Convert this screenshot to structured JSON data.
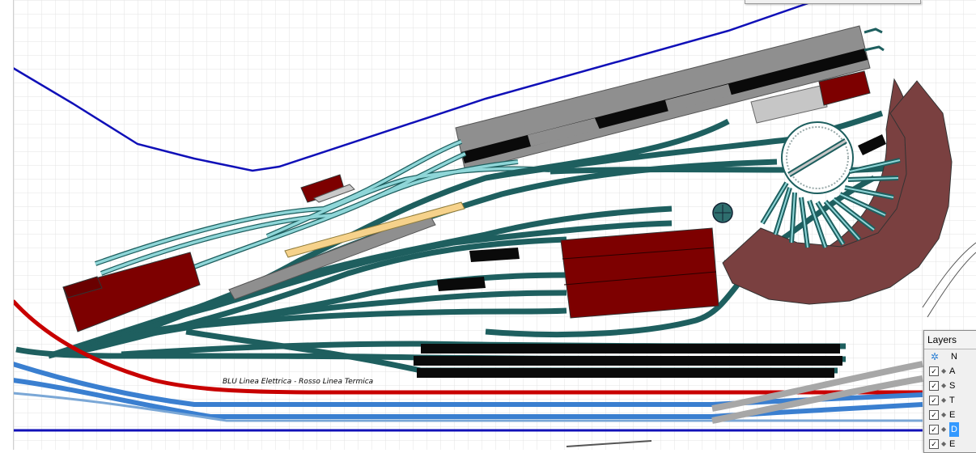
{
  "annotation": "BLU Linea Elettrica - Rosso Linea Termica",
  "layers_panel": {
    "title": "Layers",
    "header": {
      "icon": "layers-gear-icon",
      "label": "N"
    },
    "items": [
      {
        "label": "A",
        "checked": true,
        "selected": false
      },
      {
        "label": "S",
        "checked": true,
        "selected": false
      },
      {
        "label": "T",
        "checked": true,
        "selected": false
      },
      {
        "label": "E",
        "checked": true,
        "selected": false
      },
      {
        "label": "D",
        "checked": true,
        "selected": true
      },
      {
        "label": "E",
        "checked": true,
        "selected": false
      }
    ]
  },
  "colors": {
    "grid": "#e3e3e3",
    "track_teal": "#1e5f5f",
    "track_cyan": "#8fd6d8",
    "track_blue": "#3a7fd0",
    "line_electric_blue": "#1010b8",
    "line_thermal_red": "#c80000",
    "building_red": "#7d0000",
    "platform_grey": "#8f8f8f",
    "turntable_brown": "#7a4040",
    "wagon_black": "#0a0a0a"
  }
}
